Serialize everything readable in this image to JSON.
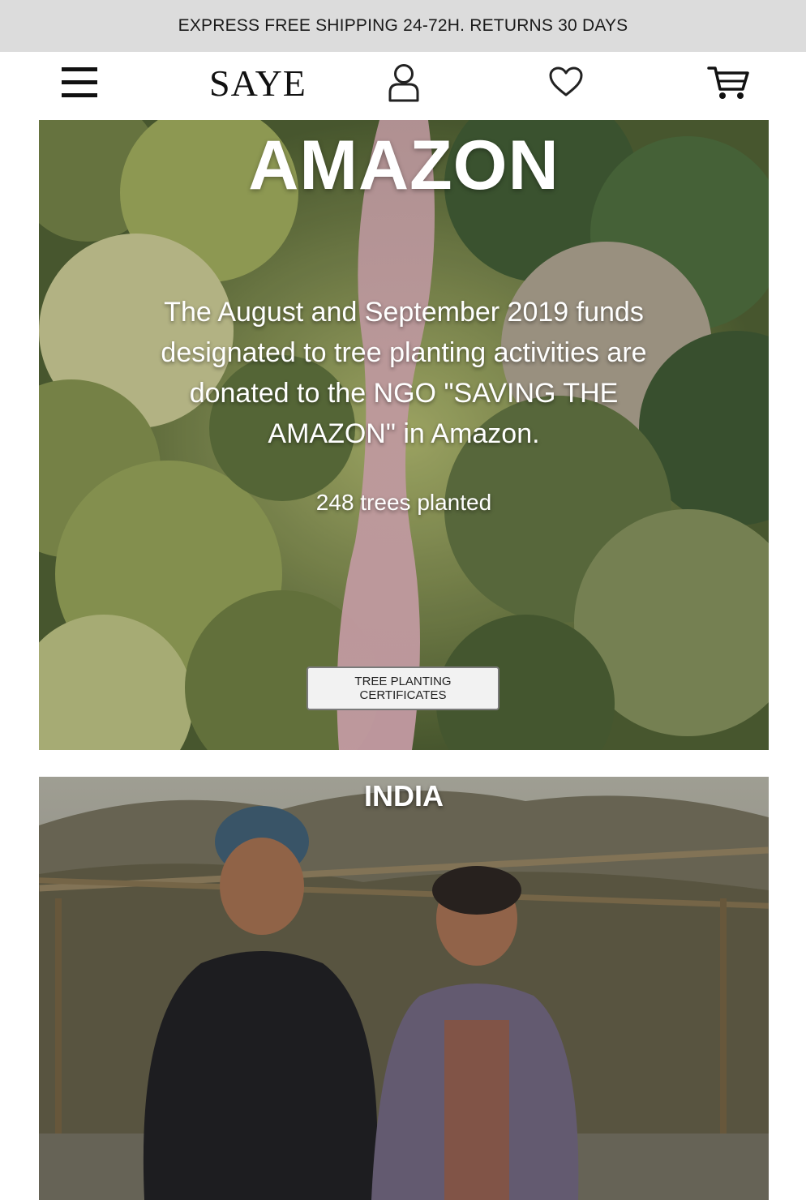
{
  "announcement": "EXPRESS FREE SHIPPING 24-72H. RETURNS 30 DAYS",
  "header": {
    "logo": "SAYE",
    "icons": [
      "menu-icon",
      "user-icon",
      "heart-icon",
      "cart-icon"
    ]
  },
  "amazon": {
    "title": "AMAZON",
    "description": "The August and September 2019 funds designated to tree planting activities are donated to the NGO \"SAVING THE AMAZON\" in Amazon.",
    "trees": "248 trees planted",
    "button_label": "TREE PLANTING CERTIFICATES"
  },
  "india": {
    "title": "INDIA"
  },
  "colors": {
    "announcement_bg": "#dcdcdc",
    "text_dark": "#111111",
    "overlay_text": "#ffffff"
  }
}
